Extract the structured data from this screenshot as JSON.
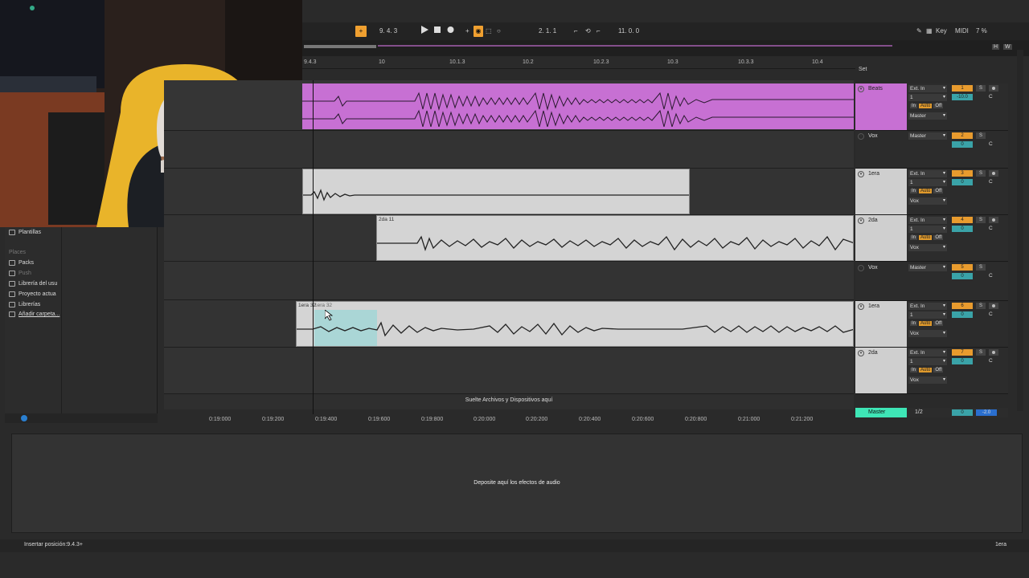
{
  "transport": {
    "arrangement_position": "9.   4.   3",
    "loop_start": "2.   1.   1",
    "loop_length": "11.   0.   0",
    "key_label": "Key",
    "midi_label": "MIDI",
    "cpu": "7 %",
    "h_label": "H",
    "w_label": "W"
  },
  "ruler": {
    "bars": [
      "9.4.3",
      "10",
      "10.1.3",
      "10.2",
      "10.2.3",
      "10.3",
      "10.3.3",
      "10.4"
    ],
    "set_label": "Set"
  },
  "browser": {
    "items": [
      {
        "label": "Plantillas",
        "kind": "item"
      },
      {
        "label": "Places",
        "kind": "head"
      },
      {
        "label": "Packs",
        "kind": "item"
      },
      {
        "label": "Push",
        "kind": "head"
      },
      {
        "label": "Librería del usu",
        "kind": "item"
      },
      {
        "label": "Proyecto actua",
        "kind": "item"
      },
      {
        "label": "Librerías",
        "kind": "item"
      },
      {
        "label": "Añadir carpeta...",
        "kind": "item"
      }
    ]
  },
  "clips": {
    "clip_2da": "2da 11",
    "clip_1era_a": "1era 32",
    "clip_1era_b": "1era 32"
  },
  "tracks": [
    {
      "name": "Beats",
      "input": "Ext. In",
      "channel": "1",
      "output": "Master",
      "number": "1",
      "volume": "-10.0",
      "pan": "C",
      "color": "#c770d3",
      "monitor": "Auto"
    },
    {
      "name": "Vox",
      "output": "Master",
      "number": "2",
      "volume": "0",
      "pan": "C",
      "group": true
    },
    {
      "name": "1era",
      "input": "Ext. In",
      "channel": "1",
      "output": "Vox",
      "number": "3",
      "volume": "0",
      "pan": "C",
      "monitor": "Auto"
    },
    {
      "name": "2da",
      "input": "Ext. In",
      "channel": "1",
      "output": "Vox",
      "number": "4",
      "volume": "0",
      "pan": "C",
      "monitor": "Auto"
    },
    {
      "name": "Vox",
      "output": "Master",
      "number": "5",
      "volume": "0",
      "pan": "C",
      "group": true
    },
    {
      "name": "1era",
      "input": "Ext. In",
      "channel": "1",
      "output": "Vox",
      "number": "6",
      "volume": "0",
      "pan": "C",
      "monitor": "Auto"
    },
    {
      "name": "2da",
      "input": "Ext. In",
      "channel": "1",
      "output": "Vox",
      "number": "7",
      "volume": "0",
      "pan": "C",
      "monitor": "Auto"
    }
  ],
  "master": {
    "name": "Master",
    "sig": "1/2",
    "volume": "0",
    "peak": "-2.0"
  },
  "monitor_labels": {
    "in": "In",
    "auto": "Auto",
    "off": "Off"
  },
  "drop_files": "Suelte Archivos y Dispositivos aquí",
  "time_ruler": [
    "0:19:000",
    "0:19:200",
    "0:19:400",
    "0:19:600",
    "0:19:800",
    "0:20:000",
    "0:20:200",
    "0:20:400",
    "0:20:600",
    "0:20:800",
    "0:21:000",
    "0:21:200"
  ],
  "device_panel": "Deposite aquí los efectos de audio",
  "status": {
    "message": "Insertar posición:9.4.3+",
    "selected_track": "1era"
  },
  "colors": {
    "accent": "#f0a030",
    "beats_clip": "#c770d3",
    "master_tab": "#3ee6b6",
    "volume": "#3aa3a8"
  }
}
